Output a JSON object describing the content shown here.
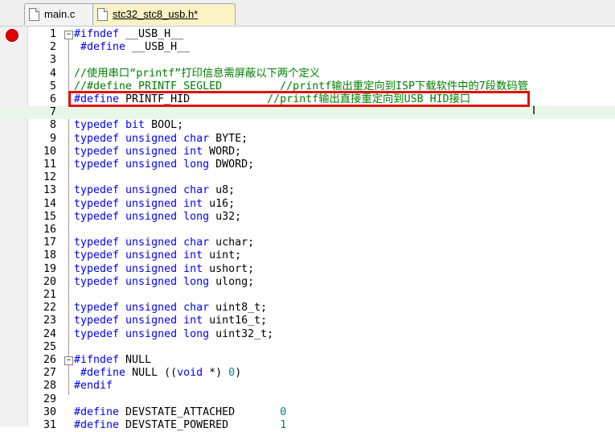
{
  "tabs": [
    {
      "label": "main.c",
      "active": false
    },
    {
      "label": "stc32_stc8_usb.h*",
      "active": true
    }
  ],
  "breakpoint_line": 1,
  "lines": [
    {
      "n": "1",
      "parts": [
        [
          "pp",
          "#ifndef "
        ],
        [
          "id",
          "__USB_H__"
        ]
      ]
    },
    {
      "n": "2",
      "parts": [
        [
          "pp",
          " #define "
        ],
        [
          "id",
          "__USB_H__"
        ]
      ]
    },
    {
      "n": "3",
      "parts": []
    },
    {
      "n": "4",
      "parts": [
        [
          "cm",
          "//使用串口“printf”打印信息需屏蔽以下两个定义"
        ]
      ]
    },
    {
      "n": "5",
      "parts": [
        [
          "cm",
          "//#define PRINTF_SEGLED         //printf输出重定向到ISP下载软件中的7段数码管"
        ]
      ]
    },
    {
      "n": "6",
      "parts": [
        [
          "pp",
          "#define "
        ],
        [
          "id",
          "PRINTF_HID            "
        ],
        [
          "cm",
          "//printf输出直接重定向到USB HID接口"
        ]
      ]
    },
    {
      "n": "7",
      "parts": [],
      "hl": true
    },
    {
      "n": "8",
      "parts": [
        [
          "kw",
          "typedef bit "
        ],
        [
          "id",
          "BOOL;"
        ]
      ]
    },
    {
      "n": "9",
      "parts": [
        [
          "kw",
          "typedef unsigned char "
        ],
        [
          "id",
          "BYTE;"
        ]
      ]
    },
    {
      "n": "10",
      "parts": [
        [
          "kw",
          "typedef unsigned int "
        ],
        [
          "id",
          "WORD;"
        ]
      ]
    },
    {
      "n": "11",
      "parts": [
        [
          "kw",
          "typedef unsigned long "
        ],
        [
          "id",
          "DWORD;"
        ]
      ]
    },
    {
      "n": "12",
      "parts": []
    },
    {
      "n": "13",
      "parts": [
        [
          "kw",
          "typedef unsigned char "
        ],
        [
          "id",
          "u8;"
        ]
      ]
    },
    {
      "n": "14",
      "parts": [
        [
          "kw",
          "typedef unsigned int "
        ],
        [
          "id",
          "u16;"
        ]
      ]
    },
    {
      "n": "15",
      "parts": [
        [
          "kw",
          "typedef unsigned long "
        ],
        [
          "id",
          "u32;"
        ]
      ]
    },
    {
      "n": "16",
      "parts": []
    },
    {
      "n": "17",
      "parts": [
        [
          "kw",
          "typedef unsigned char "
        ],
        [
          "id",
          "uchar;"
        ]
      ]
    },
    {
      "n": "18",
      "parts": [
        [
          "kw",
          "typedef unsigned int "
        ],
        [
          "id",
          "uint;"
        ]
      ]
    },
    {
      "n": "19",
      "parts": [
        [
          "kw",
          "typedef unsigned int "
        ],
        [
          "id",
          "ushort;"
        ]
      ]
    },
    {
      "n": "20",
      "parts": [
        [
          "kw",
          "typedef unsigned long "
        ],
        [
          "id",
          "ulong;"
        ]
      ]
    },
    {
      "n": "21",
      "parts": []
    },
    {
      "n": "22",
      "parts": [
        [
          "kw",
          "typedef unsigned char "
        ],
        [
          "id",
          "uint8_t;"
        ]
      ]
    },
    {
      "n": "23",
      "parts": [
        [
          "kw",
          "typedef unsigned int "
        ],
        [
          "id",
          "uint16_t;"
        ]
      ]
    },
    {
      "n": "24",
      "parts": [
        [
          "kw",
          "typedef unsigned long "
        ],
        [
          "id",
          "uint32_t;"
        ]
      ]
    },
    {
      "n": "25",
      "parts": []
    },
    {
      "n": "26",
      "parts": [
        [
          "pp",
          "#ifndef "
        ],
        [
          "id",
          "NULL"
        ]
      ]
    },
    {
      "n": "27",
      "parts": [
        [
          "pp",
          " #define "
        ],
        [
          "id",
          "NULL (("
        ],
        [
          "kw",
          "void"
        ],
        [
          "id",
          " *) "
        ],
        [
          "nm",
          "0"
        ],
        [
          "id",
          ")"
        ]
      ]
    },
    {
      "n": "28",
      "parts": [
        [
          "pp",
          "#endif"
        ]
      ]
    },
    {
      "n": "29",
      "parts": []
    },
    {
      "n": "30",
      "parts": [
        [
          "pp",
          "#define "
        ],
        [
          "id",
          "DEVSTATE_ATTACHED       "
        ],
        [
          "nm",
          "0"
        ]
      ]
    },
    {
      "n": "31",
      "parts": [
        [
          "pp",
          "#define "
        ],
        [
          "id",
          "DEVSTATE_POWERED        "
        ],
        [
          "nm",
          "1"
        ]
      ]
    }
  ],
  "fold_markers": [
    1,
    26
  ],
  "annotation": {
    "line": 6,
    "color": "#e01010"
  }
}
